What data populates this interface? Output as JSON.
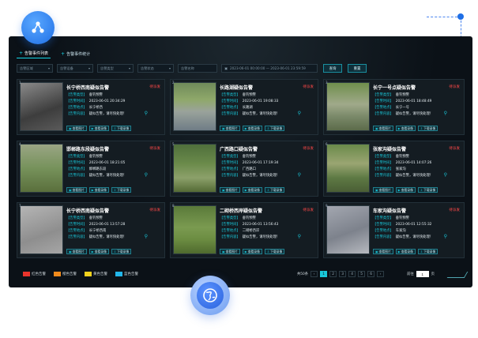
{
  "tabs": [
    {
      "label": "告警事件列表",
      "active": true
    },
    {
      "label": "告警事件统计",
      "active": false
    }
  ],
  "filters": {
    "selects": [
      "告警区域",
      "告警设备",
      "告警类型",
      "告警状态"
    ],
    "name_placeholder": "告警名称",
    "date_range": "2023-06-01 00:00:00  —  2023-06-01 23:59:59",
    "search_label": "查询",
    "reset_label": "重置"
  },
  "field_labels": {
    "type": "【告警类型】",
    "time": "【告警时间】",
    "location": "【告警地点】",
    "content": "【告警内容】"
  },
  "actions": [
    "查看图片",
    "查看录像",
    "下载录像"
  ],
  "cards": [
    {
      "num": "1",
      "title": "长宁桥西南疑似告警",
      "status": "待派发",
      "type": "垂钓预警",
      "time": "2023-06-01 20:34:29",
      "location": "长宁桥西",
      "content": "疑似告警，请尽快处理！"
    },
    {
      "num": "2",
      "title": "长路湖疑似告警",
      "status": "待派发",
      "type": "垂钓预警",
      "time": "2023-06-01 19:08:33",
      "location": "长路湖",
      "content": "疑似告警，请尽快处理！"
    },
    {
      "num": "3",
      "title": "长宁一号点疑似告警",
      "status": "待派发",
      "type": "垂钓预警",
      "time": "2023-06-01 18:48:49",
      "location": "长宁一号",
      "content": "疑似告警，请尽快处理！"
    },
    {
      "num": "4",
      "title": "邯郸路东段疑似告警",
      "status": "待派发",
      "type": "垂钓预警",
      "time": "2023-06-01 18:21:05",
      "location": "邯郸路东段",
      "content": "疑似告警，请尽快处理！"
    },
    {
      "num": "5",
      "title": "广西路口疑似告警",
      "status": "待派发",
      "type": "垂钓预警",
      "time": "2023-06-01 17:19:34",
      "location": "广西路口",
      "content": "疑似告警，请尽快处理！"
    },
    {
      "num": "6",
      "title": "张家沟疑似告警",
      "status": "待派发",
      "type": "垂钓预警",
      "time": "2023-06-01 14:07:26",
      "location": "张家沟",
      "content": "疑似告警，请尽快处理！"
    },
    {
      "num": "7",
      "title": "长宁桥西南疑似告警",
      "status": "待派发",
      "type": "垂钓预警",
      "time": "2023-06-01 13:57:28",
      "location": "长宁桥西南",
      "content": "疑似告警，请尽快处理！"
    },
    {
      "num": "8",
      "title": "二砌桥西岸疑似告警",
      "status": "待派发",
      "type": "垂钓预警",
      "time": "2023-06-01 13:56:43",
      "location": "二砌桥西岸",
      "content": "疑似告警，请尽快处理！"
    },
    {
      "num": "9",
      "title": "车家沟疑似告警",
      "status": "待派发",
      "type": "垂钓预警",
      "time": "2023-06-01 12:55:32",
      "location": "车家沟",
      "content": "疑似告警，请尽快处理！"
    }
  ],
  "legend": [
    {
      "label": "红色告警",
      "color": "#e8342c"
    },
    {
      "label": "橙色告警",
      "color": "#f08a1c"
    },
    {
      "label": "黄色告警",
      "color": "#f2d21e"
    },
    {
      "label": "蓝色告警",
      "color": "#22b6ea"
    }
  ],
  "pager": {
    "total": "共50条",
    "pages": [
      "1",
      "2",
      "3",
      "4",
      "5",
      "6"
    ],
    "current": "1",
    "goto_label": "前往",
    "page_unit": "页",
    "goto_value": "1"
  }
}
